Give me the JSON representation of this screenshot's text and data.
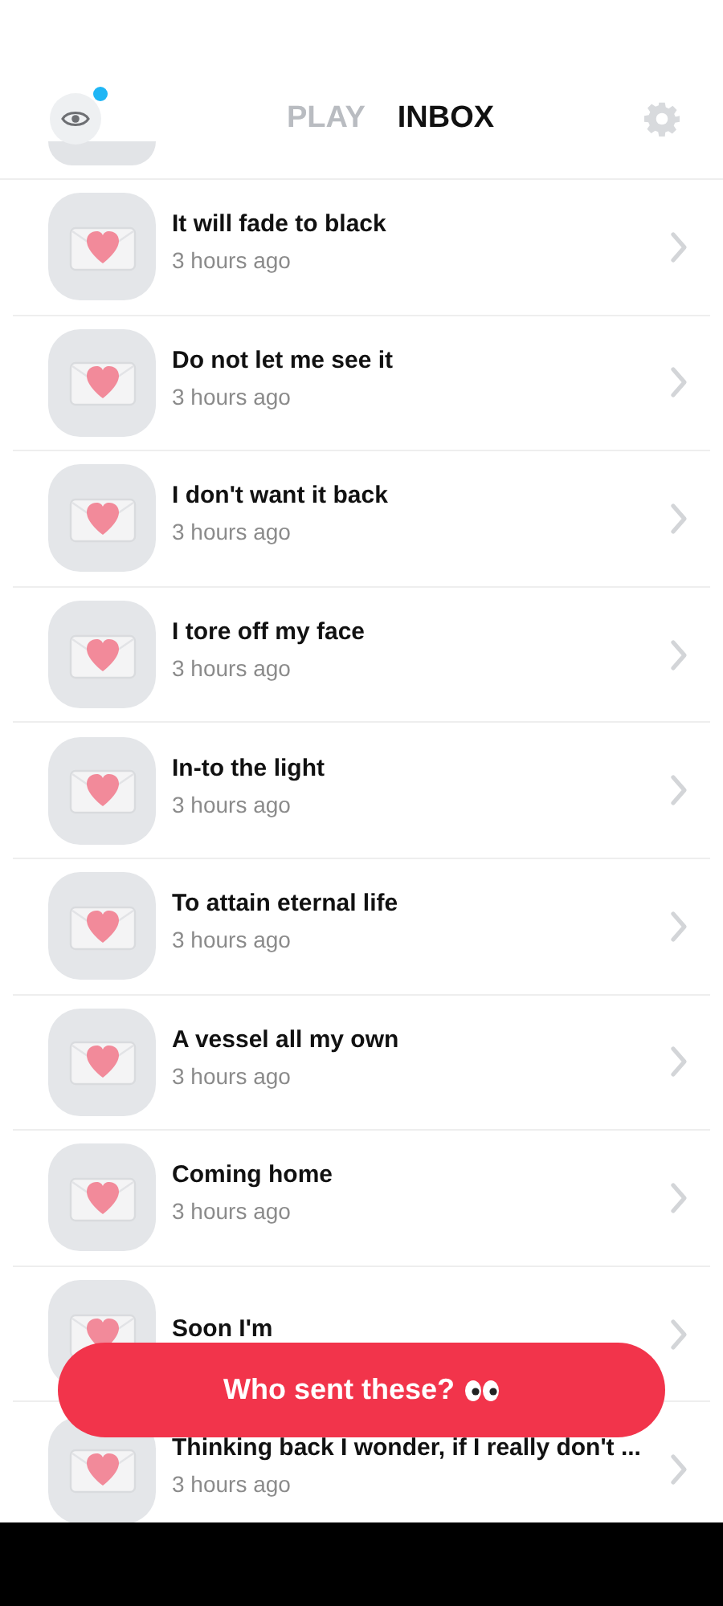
{
  "header": {
    "has_notification": true,
    "tabs": [
      {
        "label": "PLAY",
        "selected": false
      },
      {
        "label": "INBOX",
        "selected": true
      }
    ]
  },
  "messages": [
    {
      "title": "It will fade to black",
      "time": "3 hours ago"
    },
    {
      "title": "Do not let me see it",
      "time": "3 hours ago"
    },
    {
      "title": "I don't want it back",
      "time": "3 hours ago"
    },
    {
      "title": "I tore off my face",
      "time": "3 hours ago"
    },
    {
      "title": "In-to the light",
      "time": "3 hours ago"
    },
    {
      "title": "To attain eternal life",
      "time": "3 hours ago"
    },
    {
      "title": "A vessel all my own",
      "time": "3 hours ago"
    },
    {
      "title": "Coming home",
      "time": "3 hours ago"
    },
    {
      "title": "Soon I'm"
    },
    {
      "title": "Thinking back I wonder, if I really don't ...",
      "time": "3 hours ago"
    }
  ],
  "button": {
    "label": "Who sent these?"
  }
}
